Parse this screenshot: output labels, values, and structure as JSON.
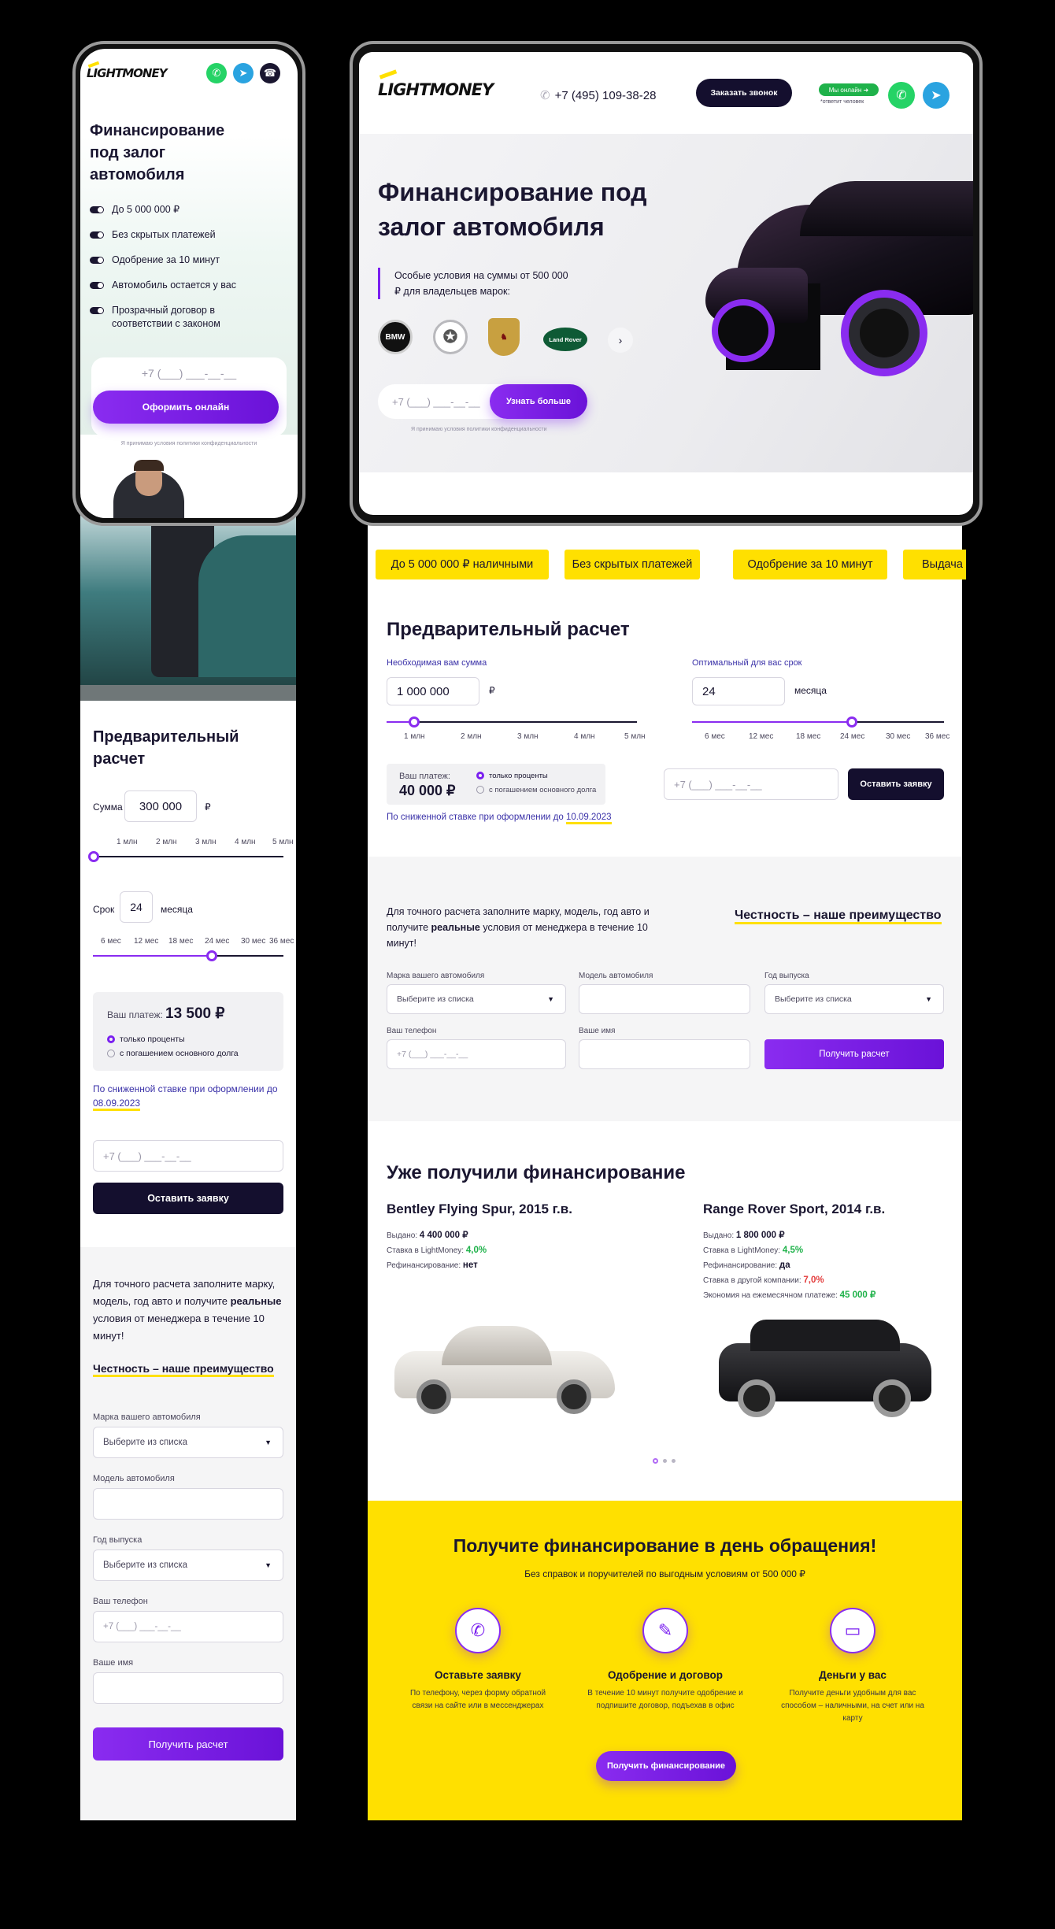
{
  "brand": {
    "logo": "LIGHTMONEY"
  },
  "mobile": {
    "title": "Финансирование под залог автомобиля",
    "features": [
      "До 5 000 000 ₽",
      "Без скрытых платежей",
      "Одобрение за 10 минут",
      "Автомобиль остается у вас",
      "Прозрачный договор в соответствии с законом"
    ],
    "phone_placeholder": "+7 (___) ___-__-__",
    "cta": "Оформить онлайн",
    "policy": "Я принимаю условия политики конфиденциальности",
    "calc_title": "Предварительный расчет",
    "sum_label": "Сумма",
    "sum_value": "300 000",
    "currency": "₽",
    "sum_ticks": [
      "1 млн",
      "2 млн",
      "3 млн",
      "4 млн",
      "5 млн"
    ],
    "sum_slider_level": 0.0,
    "term_label": "Срок",
    "term_value": "24",
    "term_unit": "месяца",
    "term_ticks": [
      "6 мес",
      "12 мес",
      "18 мес",
      "24 мес",
      "30 мес",
      "36 мес"
    ],
    "term_slider_level": 0.6,
    "payment_label": "Ваш платеж:",
    "payment_value": "13 500 ₽",
    "radio_1": "только проценты",
    "radio_2": "с погашением основного долга",
    "rate_note": "По сниженной ставке при оформлении до",
    "rate_date": "08.09.2023",
    "phone_input": "+7 (___) ___-__-__",
    "submit": "Оставить заявку",
    "form_intro_1": "Для точного расчета заполните марку, модель, год авто и получите",
    "form_intro_bold": "реальные",
    "form_intro_2": "условия от менеджера в течение 10 минут!",
    "honesty": "Честность – наше преимущество",
    "brand_label": "Марка вашего автомобиля",
    "select_placeholder": "Выберите из списка",
    "model_label": "Модель автомобиля",
    "year_label": "Год выпуска",
    "tel_label": "Ваш телефон",
    "tel_placeholder": "+7 (___) ___-__-__",
    "name_label": "Ваше имя",
    "get_calc": "Получить расчет"
  },
  "desktop": {
    "phone": "+7 (495) 109-38-28",
    "call_btn": "Заказать звонок",
    "online_badge": "Мы онлайн",
    "online_sub": "*ответит человек",
    "hero_title": "Финансирование под залог автомобиля",
    "hero_note": "Особые условия на суммы от 500 000 ₽ для владельцев марок:",
    "brands": [
      "BMW",
      "Mercedes",
      "Porsche",
      "Land Rover"
    ],
    "phone_placeholder": "+7 (___) ___-__-__",
    "learn_more": "Узнать больше",
    "policy": "Я принимаю условия политики конфиденциальности",
    "chips": [
      "До 5 000 000 ₽ наличными",
      "Без скрытых платежей",
      "Одобрение за 10 минут",
      "Выдача"
    ],
    "calc_title": "Предварительный расчет",
    "sum_label": "Необходимая вам сумма",
    "sum_value": "1 000 000",
    "currency": "₽",
    "sum_ticks": [
      "1 млн",
      "2 млн",
      "3 млн",
      "4 млн",
      "5 млн"
    ],
    "sum_slider_level": 0.1,
    "term_label": "Оптимальный для вас срок",
    "term_value": "24",
    "term_unit": "месяца",
    "term_ticks": [
      "6 мес",
      "12 мес",
      "18 мес",
      "24 мес",
      "30 мес",
      "36 мес"
    ],
    "term_slider_level": 0.6,
    "payment_label": "Ваш платеж:",
    "payment_value": "40 000 ₽",
    "radio_1": "только проценты",
    "radio_2": "с погашением основного долга",
    "rate_note": "По сниженной ставке при оформлении до",
    "rate_date": "10.09.2023",
    "phone_input": "+7 (___) ___-__-__",
    "submit": "Оставить заявку",
    "form_intro_1": "Для точного расчета заполните марку, модель, год авто и получите",
    "form_intro_bold": "реальные",
    "form_intro_2": "условия от менеджера в течение 10 минут!",
    "honesty": "Честность – наше преимущество",
    "brand_label": "Марка вашего автомобиля",
    "model_label": "Модель автомобиля",
    "year_label": "Год выпуска",
    "select_placeholder": "Выберите из списка",
    "tel_label": "Ваш телефон",
    "tel_placeholder": "+7 (___) ___-__-__",
    "name_label": "Ваше имя",
    "get_calc": "Получить расчет",
    "cases_title": "Уже получили финансирование",
    "case_1": {
      "title": "Bentley Flying Spur, 2015 г.в.",
      "issued_label": "Выдано:",
      "issued": "4 400 000 ₽",
      "rate_label": "Ставка в LightMoney:",
      "rate": "4,0%",
      "refin_label": "Рефинансирование:",
      "refin": "нет"
    },
    "case_2": {
      "title": "Range Rover Sport, 2014 г.в.",
      "issued_label": "Выдано:",
      "issued": "1 800 000 ₽",
      "rate_label": "Ставка в LightMoney:",
      "rate": "4,5%",
      "refin_label": "Рефинансирование:",
      "refin": "да",
      "other_label": "Ставка в другой компании:",
      "other": "7,0%",
      "save_label": "Экономия на ежемесячном платеже:",
      "save": "45 000 ₽"
    },
    "cta_title": "Получите финансирование в день обращения!",
    "cta_sub": "Без справок и поручителей по выгодным условиям от 500 000 ₽",
    "steps": [
      {
        "title": "Оставьте заявку",
        "text": "По телефону, через форму обратной связи на сайте или в мессенджерах"
      },
      {
        "title": "Одобрение и договор",
        "text": "В течение 10 минут получите одобрение и подпишите договор, подъехав в офис"
      },
      {
        "title": "Деньги у вас",
        "text": "Получите деньги удобным для вас способом – наличными, на счет или на карту"
      }
    ],
    "cta_btn": "Получить финансирование"
  },
  "colors": {
    "accent": "#7a1ff0",
    "yellow": "#ffe000",
    "dark": "#140f2e",
    "green": "#1fb24a",
    "red": "#e33b3b"
  }
}
